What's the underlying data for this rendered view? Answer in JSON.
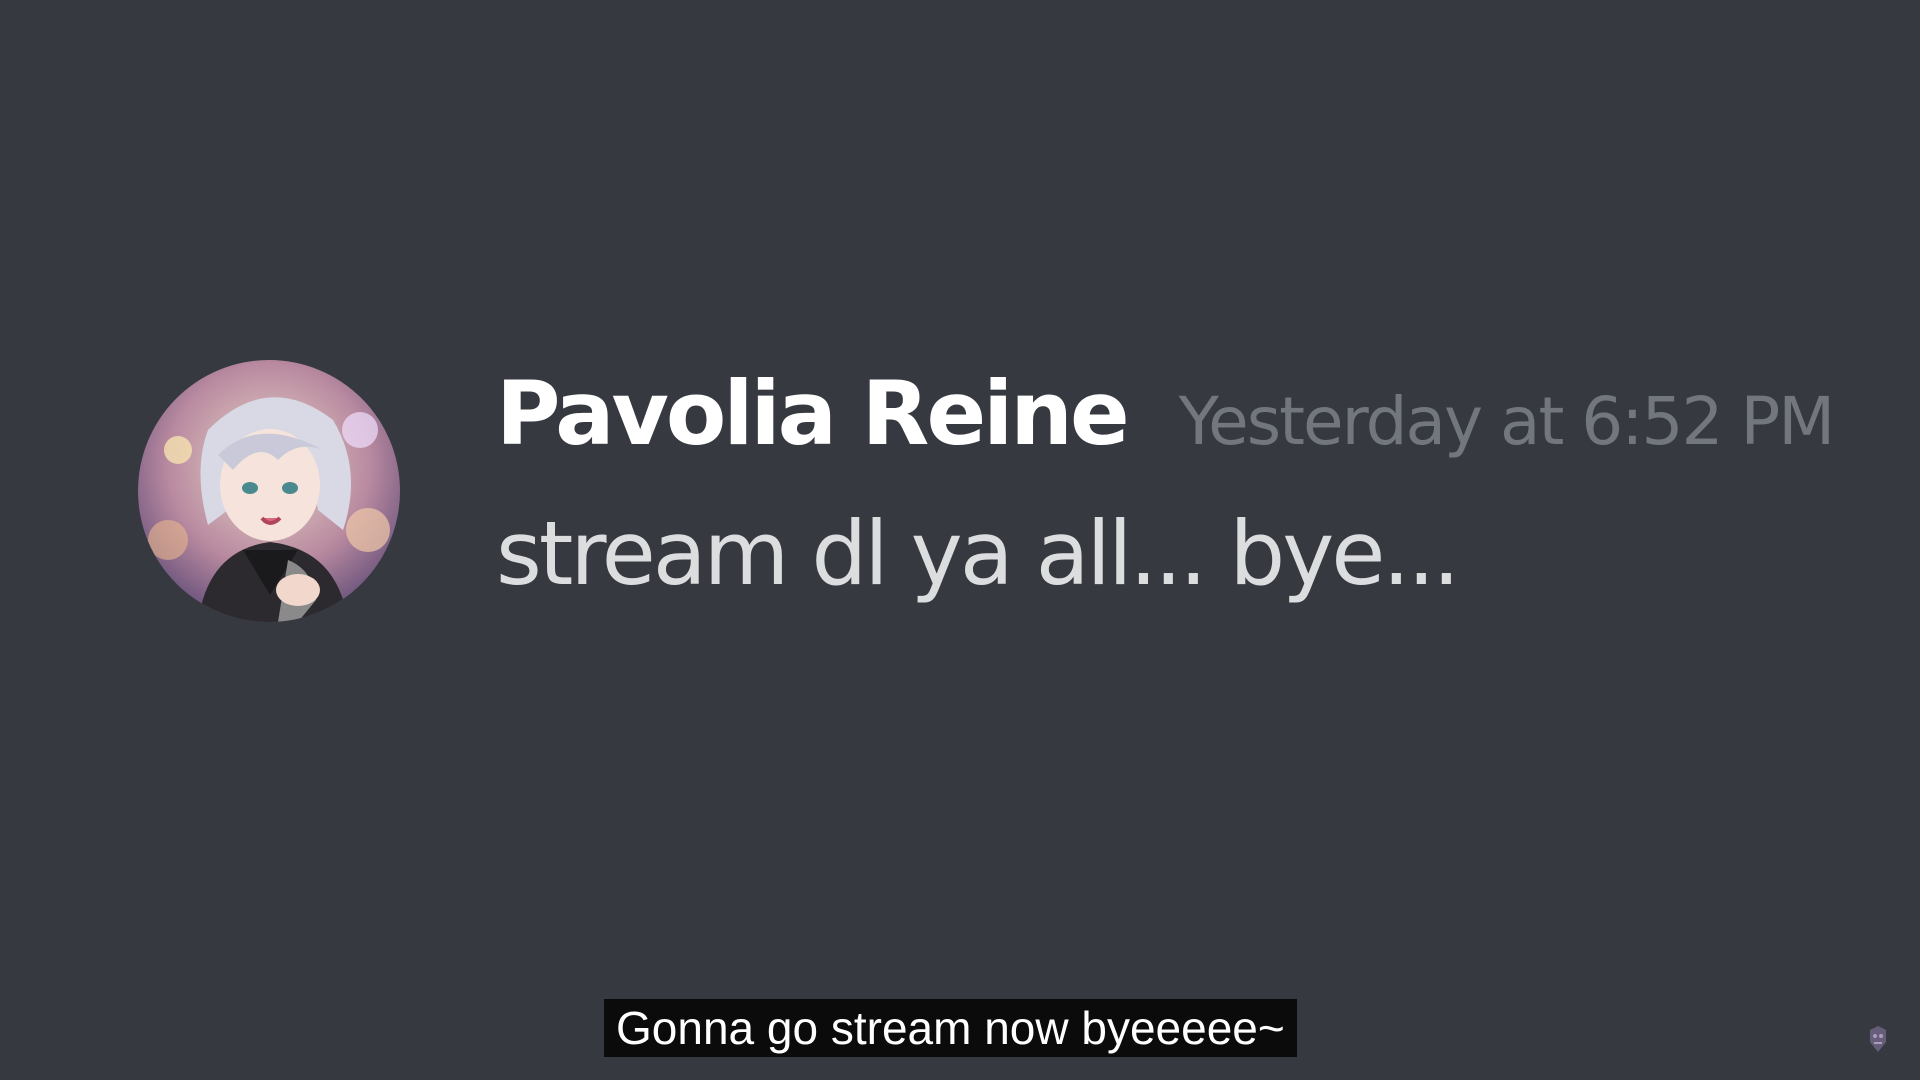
{
  "message": {
    "username": "Pavolia Reine",
    "timestamp": "Yesterday at 6:52 PM",
    "content": "stream dl ya all... bye..."
  },
  "subtitle": {
    "text": "Gonna go stream now byeeeee~"
  },
  "icons": {
    "avatar": "avatar-image",
    "watermark": "channel-watermark-icon"
  },
  "colors": {
    "background": "#363940",
    "username": "#ffffff",
    "timestamp": "#72767d",
    "content": "#dcddde",
    "caption_bg": "#0b0b0c"
  }
}
